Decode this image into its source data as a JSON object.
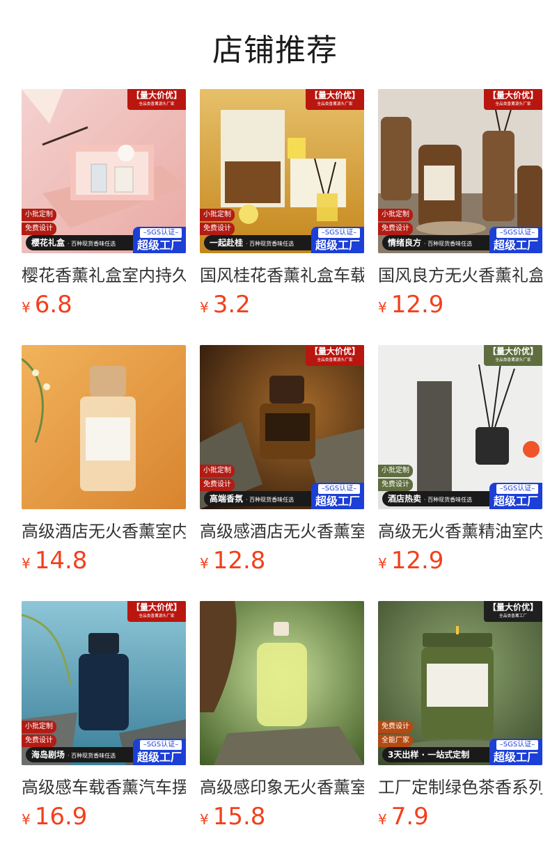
{
  "page_title": "店铺推荐",
  "badges": {
    "promo_title": "【量大价优】",
    "promo_sub": "全品类香薰源头厂家",
    "promo_sub_alt": "全品类香薰工厂",
    "tag_batch": "小批定制",
    "tag_design": "免费设计",
    "tag_allround": "全能厂家",
    "sgs": "–SGS认证–",
    "factory": "超级工厂",
    "slogan_suffix": "· 百种现货香味任选"
  },
  "products": [
    {
      "name": "樱花香薰礼盒室内持久留香",
      "currency": "¥",
      "price": "6.8",
      "slogan": "樱花礼盒"
    },
    {
      "name": "国风桂花香薰礼盒车载",
      "currency": "¥",
      "price": "3.2",
      "slogan": "一起赴桂"
    },
    {
      "name": "国风良方无火香薰礼盒",
      "currency": "¥",
      "price": "12.9",
      "slogan": "情绪良方"
    },
    {
      "name": "高级酒店无火香薰室内",
      "currency": "¥",
      "price": "14.8",
      "slogan": ""
    },
    {
      "name": "高级感酒店无火香薰室内",
      "currency": "¥",
      "price": "12.8",
      "slogan": "高端香氛"
    },
    {
      "name": "高级无火香薰精油室内",
      "currency": "¥",
      "price": "12.9",
      "slogan": "酒店热卖"
    },
    {
      "name": "高级感车载香薰汽车摆件",
      "currency": "¥",
      "price": "16.9",
      "slogan": "海岛剧场"
    },
    {
      "name": "高级感印象无火香薰室内",
      "currency": "¥",
      "price": "15.8",
      "slogan": ""
    },
    {
      "name": "工厂定制绿色茶香系列",
      "currency": "¥",
      "price": "7.9",
      "slogan": "3天出样 · 一站式定制"
    }
  ]
}
